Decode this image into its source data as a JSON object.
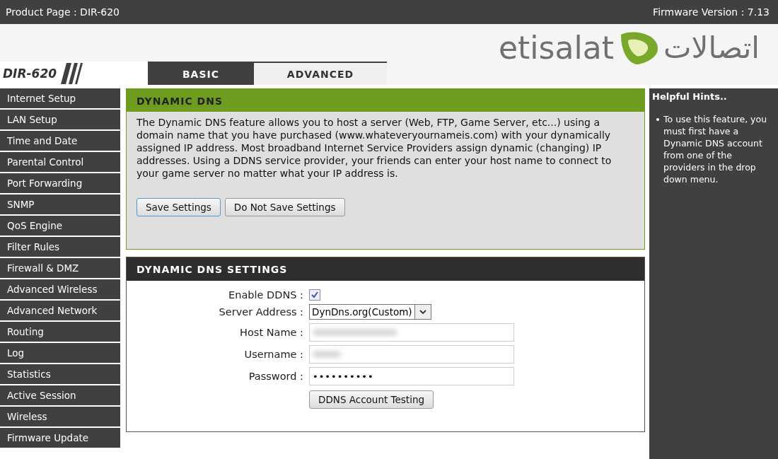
{
  "top_bar": {
    "product": "Product Page :  DIR-620",
    "firmware": "Firmware Version : 7.13"
  },
  "logo": {
    "latin": "etisalat",
    "arabic": "اتصالات"
  },
  "model": "DIR-620",
  "tabs": [
    {
      "label": "BASIC",
      "selected": false
    },
    {
      "label": "ADVANCED",
      "selected": true
    }
  ],
  "sidebar": {
    "items": [
      "Internet Setup",
      "LAN Setup",
      "Time and Date",
      "Parental Control",
      "Port Forwarding",
      "SNMP",
      "QoS Engine",
      "Filter Rules",
      "Firewall & DMZ",
      "Advanced Wireless",
      "Advanced Network",
      "Routing",
      "Log",
      "Statistics",
      "Active Session",
      "Wireless",
      "Firmware Update"
    ]
  },
  "intro": {
    "title": "DYNAMIC DNS",
    "text": "The Dynamic DNS feature allows you to host a server (Web, FTP, Game Server, etc...) using a domain name that you have purchased (www.whateveryournameis.com) with your dynamically assigned IP address. Most broadband Internet Service Providers assign dynamic (changing) IP addresses. Using a DDNS service provider, your friends can enter your host name to connect to your game server no matter what your IP address is.",
    "buttons": [
      "Save Settings",
      "Do Not Save Settings"
    ]
  },
  "settings": {
    "title": "DYNAMIC DNS SETTINGS",
    "fields": [
      {
        "kind": "checkbox",
        "label": "Enable DDNS :",
        "checked": true
      },
      {
        "kind": "select",
        "label": "Server Address :",
        "value": "DynDns.org(Custom)"
      },
      {
        "kind": "blurred",
        "label": "Host Name :"
      },
      {
        "kind": "blurred",
        "label": "Username :"
      },
      {
        "kind": "text",
        "label": "Password :",
        "value": "••••••••••"
      }
    ],
    "test_button": "DDNS Account Testing"
  },
  "hints": {
    "title": "Helpful Hints..",
    "items": [
      "To use this feature, you must first have a Dynamic DNS account from one of the providers in the drop down menu."
    ]
  }
}
